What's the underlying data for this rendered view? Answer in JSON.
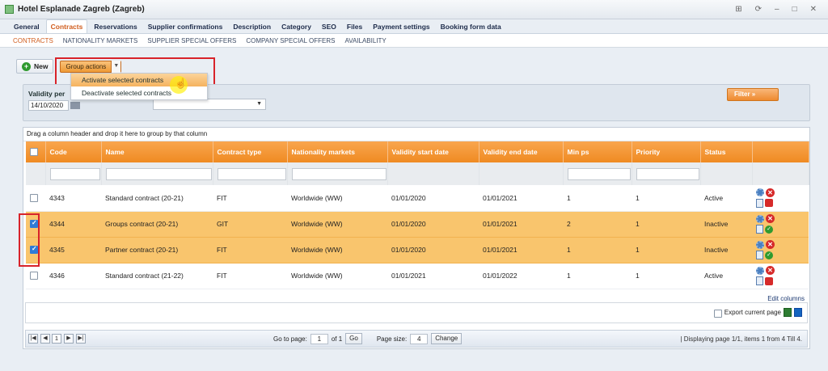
{
  "window": {
    "title": "Hotel Esplanade Zagreb (Zagreb)"
  },
  "main_tabs": [
    "General",
    "Contracts",
    "Reservations",
    "Supplier confirmations",
    "Description",
    "Category",
    "SEO",
    "Files",
    "Payment settings",
    "Booking form data"
  ],
  "sub_tabs": [
    "CONTRACTS",
    "NATIONALITY MARKETS",
    "SUPPLIER SPECIAL OFFERS",
    "COMPANY SPECIAL OFFERS",
    "AVAILABILITY"
  ],
  "toolbar": {
    "new_label": "New",
    "group_actions_label": "Group actions"
  },
  "group_actions_menu": [
    "Activate selected contracts",
    "Deactivate selected contracts"
  ],
  "filter": {
    "validity_label": "Validity per",
    "date_value": "14/10/2020",
    "filter_button": "Filter"
  },
  "grid": {
    "drag_hint": "Drag a column header and drop it here to group by that column",
    "columns": [
      "Code",
      "Name",
      "Contract type",
      "Nationality markets",
      "Validity start date",
      "Validity end date",
      "Min ps",
      "Priority",
      "Status"
    ],
    "rows": [
      {
        "checked": false,
        "code": "4343",
        "name": "Standard contract (20-21)",
        "type": "FIT",
        "markets": "Worldwide (WW)",
        "start": "01/01/2020",
        "end": "01/01/2021",
        "min_ps": "1",
        "priority": "1",
        "status": "Active"
      },
      {
        "checked": true,
        "code": "4344",
        "name": "Groups contract (20-21)",
        "type": "GIT",
        "markets": "Worldwide (WW)",
        "start": "01/01/2020",
        "end": "01/01/2021",
        "min_ps": "2",
        "priority": "1",
        "status": "Inactive"
      },
      {
        "checked": true,
        "code": "4345",
        "name": "Partner contract (20-21)",
        "type": "FIT",
        "markets": "Worldwide (WW)",
        "start": "01/01/2020",
        "end": "01/01/2021",
        "min_ps": "1",
        "priority": "1",
        "status": "Inactive"
      },
      {
        "checked": false,
        "code": "4346",
        "name": "Standard contract (21-22)",
        "type": "FIT",
        "markets": "Worldwide (WW)",
        "start": "01/01/2021",
        "end": "01/01/2022",
        "min_ps": "1",
        "priority": "1",
        "status": "Active"
      }
    ],
    "edit_columns": "Edit columns",
    "export_label": "Export current page"
  },
  "pager": {
    "page_number": "1",
    "go_to_page_label": "Go to page:",
    "go_to_page_value": "1",
    "of_label": "of 1",
    "go_button": "Go",
    "page_size_label": "Page size:",
    "page_size_value": "4",
    "change_button": "Change",
    "info": "| Displaying page 1/1, items 1 from 4 Till 4."
  }
}
